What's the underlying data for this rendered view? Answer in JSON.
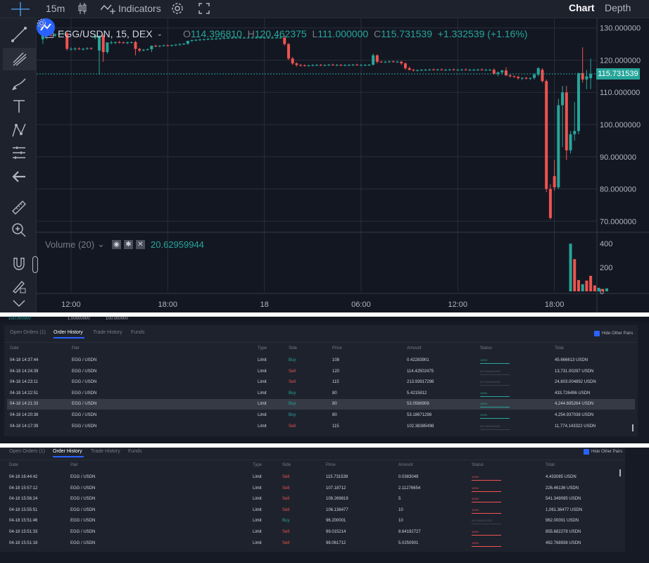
{
  "toolbar": {
    "interval": "15m",
    "indicators_label": "Indicators",
    "chart_tab": "Chart",
    "depth_tab": "Depth"
  },
  "legend": {
    "symbol": "EGG/USDN, 15, DEX",
    "ohlc": {
      "o_key": "O",
      "o_val": "114.396810",
      "h_key": "H",
      "h_val": "120.462375",
      "l_key": "L",
      "l_val": "111.000000",
      "c_key": "C",
      "c_val": "115.731539",
      "change": "+1.332539 (+1.16%)"
    },
    "volume_label": "Volume (20)",
    "volume_value": "20.62959944"
  },
  "price_badge": "115.731539",
  "colors": {
    "up": "#26a69a",
    "down": "#ef5350",
    "accent": "#2962ff",
    "bg": "#131722"
  },
  "chart_data": {
    "type": "candlestick",
    "price_axis_ticks": [
      "130.000000",
      "120.000000",
      "110.000000",
      "100.000000",
      "90.000000",
      "80.000000",
      "70.000000"
    ],
    "price_axis_values": [
      130,
      120,
      110,
      100,
      90,
      80,
      70
    ],
    "volume_axis_ticks": [
      "400",
      "200",
      "0"
    ],
    "volume_axis_values": [
      400,
      200,
      0
    ],
    "time_ticks": [
      "12:00",
      "18:00",
      "18",
      "06:00",
      "12:00",
      "18:00"
    ],
    "time_tick_index": [
      7,
      31,
      55,
      79,
      103,
      127
    ],
    "ylim": [
      67,
      133
    ],
    "volume_ylim": [
      0,
      460
    ],
    "last_price": 115.731539,
    "candles": [
      {
        "o": 126.5,
        "h": 127.8,
        "l": 125.0,
        "c": 128.0
      },
      {
        "o": 127.5,
        "h": 128.5,
        "l": 126.5,
        "c": 127.8
      },
      {
        "o": 127.8,
        "h": 128.2,
        "l": 127.2,
        "c": 127.6
      },
      {
        "o": 127.6,
        "h": 128.4,
        "l": 127.2,
        "c": 128.0
      },
      {
        "o": 128.0,
        "h": 128.5,
        "l": 127.6,
        "c": 128.2
      },
      {
        "o": 128.2,
        "h": 128.5,
        "l": 127.8,
        "c": 128.3
      },
      {
        "o": 128.3,
        "h": 128.6,
        "l": 123.0,
        "c": 123.5
      },
      {
        "o": 123.5,
        "h": 124.0,
        "l": 123.0,
        "c": 123.5
      },
      {
        "o": 123.5,
        "h": 124.0,
        "l": 123.0,
        "c": 123.6
      },
      {
        "o": 123.6,
        "h": 124.0,
        "l": 123.2,
        "c": 123.4
      },
      {
        "o": 123.4,
        "h": 123.8,
        "l": 123.0,
        "c": 123.5
      },
      {
        "o": 123.5,
        "h": 124.0,
        "l": 123.2,
        "c": 123.7
      },
      {
        "o": 123.7,
        "h": 124.0,
        "l": 123.3,
        "c": 123.6
      },
      {
        "o": 127.0,
        "h": 128.0,
        "l": 126.5,
        "c": 127.6
      },
      {
        "o": 123.0,
        "h": 127.6,
        "l": 115.5,
        "c": 127.6
      },
      {
        "o": 127.6,
        "h": 128.0,
        "l": 119.5,
        "c": 122.5
      },
      {
        "o": 122.5,
        "h": 125.5,
        "l": 122.0,
        "c": 125.5
      },
      {
        "o": 125.5,
        "h": 126.0,
        "l": 125.0,
        "c": 125.5
      },
      {
        "o": 125.5,
        "h": 125.8,
        "l": 125.0,
        "c": 125.6
      },
      {
        "o": 125.6,
        "h": 126.0,
        "l": 125.2,
        "c": 125.5
      },
      {
        "o": 125.5,
        "h": 125.8,
        "l": 125.2,
        "c": 125.4
      },
      {
        "o": 125.4,
        "h": 125.8,
        "l": 125.0,
        "c": 125.5
      },
      {
        "o": 125.5,
        "h": 125.8,
        "l": 125.2,
        "c": 125.6
      },
      {
        "o": 125.6,
        "h": 126.0,
        "l": 121.5,
        "c": 123.5
      },
      {
        "o": 123.5,
        "h": 123.8,
        "l": 122.5,
        "c": 123.0
      },
      {
        "o": 123.0,
        "h": 123.5,
        "l": 122.8,
        "c": 123.2
      },
      {
        "o": 123.2,
        "h": 123.6,
        "l": 123.0,
        "c": 123.4
      },
      {
        "o": 123.4,
        "h": 123.8,
        "l": 122.5,
        "c": 124.5
      },
      {
        "o": 124.5,
        "h": 124.8,
        "l": 124.0,
        "c": 124.3
      },
      {
        "o": 124.3,
        "h": 124.6,
        "l": 124.0,
        "c": 124.5
      },
      {
        "o": 124.5,
        "h": 124.8,
        "l": 124.2,
        "c": 124.6
      },
      {
        "o": 124.6,
        "h": 124.9,
        "l": 124.3,
        "c": 124.5
      },
      {
        "o": 124.5,
        "h": 124.8,
        "l": 124.2,
        "c": 124.7
      },
      {
        "o": 124.7,
        "h": 125.0,
        "l": 124.4,
        "c": 124.8
      },
      {
        "o": 124.8,
        "h": 125.2,
        "l": 124.5,
        "c": 125.0
      },
      {
        "o": 125.0,
        "h": 125.3,
        "l": 124.7,
        "c": 125.1
      },
      {
        "o": 125.1,
        "h": 126.0,
        "l": 124.8,
        "c": 126.0
      },
      {
        "o": 126.0,
        "h": 126.4,
        "l": 125.7,
        "c": 126.2
      },
      {
        "o": 126.2,
        "h": 126.5,
        "l": 125.9,
        "c": 126.3
      },
      {
        "o": 126.3,
        "h": 126.6,
        "l": 126.0,
        "c": 126.4
      },
      {
        "o": 126.4,
        "h": 126.7,
        "l": 126.1,
        "c": 126.5
      },
      {
        "o": 126.5,
        "h": 126.8,
        "l": 126.2,
        "c": 126.6
      },
      {
        "o": 126.6,
        "h": 126.9,
        "l": 126.3,
        "c": 126.6
      },
      {
        "o": 126.6,
        "h": 126.9,
        "l": 126.3,
        "c": 126.7
      },
      {
        "o": 126.7,
        "h": 127.0,
        "l": 126.4,
        "c": 126.8
      },
      {
        "o": 126.8,
        "h": 127.1,
        "l": 126.5,
        "c": 126.9
      },
      {
        "o": 126.9,
        "h": 127.2,
        "l": 126.6,
        "c": 126.9
      },
      {
        "o": 126.9,
        "h": 127.2,
        "l": 126.6,
        "c": 127.0
      },
      {
        "o": 127.0,
        "h": 127.3,
        "l": 126.7,
        "c": 127.0
      },
      {
        "o": 127.0,
        "h": 127.3,
        "l": 126.7,
        "c": 127.0
      },
      {
        "o": 127.0,
        "h": 127.3,
        "l": 126.7,
        "c": 127.0
      },
      {
        "o": 127.0,
        "h": 127.3,
        "l": 126.7,
        "c": 127.0
      },
      {
        "o": 127.0,
        "h": 127.3,
        "l": 126.7,
        "c": 127.0
      },
      {
        "o": 127.0,
        "h": 127.3,
        "l": 126.7,
        "c": 127.0
      },
      {
        "o": 127.0,
        "h": 127.3,
        "l": 126.7,
        "c": 127.0
      },
      {
        "o": 127.0,
        "h": 127.3,
        "l": 126.7,
        "c": 127.0
      },
      {
        "o": 127.0,
        "h": 127.3,
        "l": 126.7,
        "c": 127.0
      },
      {
        "o": 127.0,
        "h": 127.3,
        "l": 126.7,
        "c": 127.0
      },
      {
        "o": 127.0,
        "h": 127.3,
        "l": 126.7,
        "c": 127.0
      },
      {
        "o": 127.0,
        "h": 127.3,
        "l": 126.7,
        "c": 127.0
      },
      {
        "o": 127.0,
        "h": 127.5,
        "l": 124.5,
        "c": 125.0
      },
      {
        "o": 125.0,
        "h": 125.3,
        "l": 120.0,
        "c": 120.5
      },
      {
        "o": 120.5,
        "h": 121.0,
        "l": 118.5,
        "c": 119.0
      },
      {
        "o": 119.0,
        "h": 119.3,
        "l": 118.0,
        "c": 118.5
      },
      {
        "o": 118.5,
        "h": 118.8,
        "l": 118.0,
        "c": 118.4
      },
      {
        "o": 118.4,
        "h": 118.7,
        "l": 118.0,
        "c": 118.3
      },
      {
        "o": 118.3,
        "h": 118.6,
        "l": 118.0,
        "c": 118.4
      },
      {
        "o": 118.4,
        "h": 118.7,
        "l": 118.1,
        "c": 118.5
      },
      {
        "o": 118.5,
        "h": 118.8,
        "l": 118.2,
        "c": 118.5
      },
      {
        "o": 118.5,
        "h": 118.8,
        "l": 118.2,
        "c": 118.4
      },
      {
        "o": 118.4,
        "h": 118.7,
        "l": 118.1,
        "c": 118.5
      },
      {
        "o": 118.5,
        "h": 118.8,
        "l": 118.2,
        "c": 118.6
      },
      {
        "o": 118.6,
        "h": 118.9,
        "l": 118.3,
        "c": 118.5
      },
      {
        "o": 118.5,
        "h": 118.8,
        "l": 118.2,
        "c": 118.5
      },
      {
        "o": 118.5,
        "h": 118.8,
        "l": 118.2,
        "c": 118.4
      },
      {
        "o": 118.4,
        "h": 118.7,
        "l": 118.1,
        "c": 118.5
      },
      {
        "o": 118.5,
        "h": 118.8,
        "l": 118.2,
        "c": 118.5
      },
      {
        "o": 118.5,
        "h": 118.8,
        "l": 118.2,
        "c": 118.6
      },
      {
        "o": 118.6,
        "h": 118.9,
        "l": 118.3,
        "c": 118.5
      },
      {
        "o": 118.5,
        "h": 118.8,
        "l": 118.2,
        "c": 118.5
      },
      {
        "o": 118.5,
        "h": 118.8,
        "l": 118.2,
        "c": 118.5
      },
      {
        "o": 118.5,
        "h": 118.8,
        "l": 118.2,
        "c": 118.6
      },
      {
        "o": 118.6,
        "h": 122.0,
        "l": 118.3,
        "c": 121.5
      },
      {
        "o": 121.5,
        "h": 121.8,
        "l": 119.0,
        "c": 119.5
      },
      {
        "o": 119.5,
        "h": 119.8,
        "l": 119.2,
        "c": 119.4
      },
      {
        "o": 119.4,
        "h": 119.7,
        "l": 119.1,
        "c": 119.5
      },
      {
        "o": 119.5,
        "h": 119.8,
        "l": 119.2,
        "c": 119.6
      },
      {
        "o": 119.6,
        "h": 119.9,
        "l": 119.3,
        "c": 119.5
      },
      {
        "o": 119.5,
        "h": 119.8,
        "l": 119.2,
        "c": 119.5
      },
      {
        "o": 119.5,
        "h": 119.8,
        "l": 118.5,
        "c": 119.0
      },
      {
        "o": 119.0,
        "h": 119.3,
        "l": 117.0,
        "c": 117.5
      },
      {
        "o": 117.5,
        "h": 118.0,
        "l": 116.8,
        "c": 117.0
      },
      {
        "o": 117.0,
        "h": 117.3,
        "l": 116.5,
        "c": 116.8
      },
      {
        "o": 116.8,
        "h": 117.1,
        "l": 116.5,
        "c": 116.9
      },
      {
        "o": 116.9,
        "h": 117.2,
        "l": 116.6,
        "c": 117.0
      },
      {
        "o": 117.0,
        "h": 117.3,
        "l": 116.7,
        "c": 117.0
      },
      {
        "o": 117.0,
        "h": 117.3,
        "l": 116.7,
        "c": 117.1
      },
      {
        "o": 117.1,
        "h": 117.4,
        "l": 116.8,
        "c": 117.0
      },
      {
        "o": 117.0,
        "h": 117.3,
        "l": 116.7,
        "c": 117.1
      },
      {
        "o": 117.1,
        "h": 117.4,
        "l": 116.8,
        "c": 117.0
      },
      {
        "o": 117.0,
        "h": 117.3,
        "l": 116.7,
        "c": 117.0
      },
      {
        "o": 117.0,
        "h": 117.3,
        "l": 116.7,
        "c": 117.1
      },
      {
        "o": 117.1,
        "h": 117.4,
        "l": 116.8,
        "c": 117.0
      },
      {
        "o": 117.0,
        "h": 117.3,
        "l": 116.7,
        "c": 117.0
      },
      {
        "o": 117.0,
        "h": 117.3,
        "l": 116.7,
        "c": 117.1
      },
      {
        "o": 117.1,
        "h": 117.4,
        "l": 116.8,
        "c": 117.0
      },
      {
        "o": 117.0,
        "h": 117.3,
        "l": 116.7,
        "c": 117.0
      },
      {
        "o": 117.0,
        "h": 117.3,
        "l": 116.7,
        "c": 117.0
      },
      {
        "o": 117.0,
        "h": 117.3,
        "l": 116.7,
        "c": 117.1
      },
      {
        "o": 117.1,
        "h": 117.4,
        "l": 116.8,
        "c": 117.0
      },
      {
        "o": 117.0,
        "h": 117.3,
        "l": 116.7,
        "c": 117.0
      },
      {
        "o": 117.0,
        "h": 117.3,
        "l": 116.7,
        "c": 117.0
      },
      {
        "o": 117.0,
        "h": 117.5,
        "l": 115.5,
        "c": 115.8
      },
      {
        "o": 115.8,
        "h": 116.5,
        "l": 115.0,
        "c": 116.2
      },
      {
        "o": 116.2,
        "h": 117.0,
        "l": 115.5,
        "c": 116.8
      },
      {
        "o": 116.8,
        "h": 117.8,
        "l": 115.0,
        "c": 115.3
      },
      {
        "o": 115.3,
        "h": 115.8,
        "l": 114.6,
        "c": 115.0
      },
      {
        "o": 115.0,
        "h": 115.3,
        "l": 114.5,
        "c": 114.8
      },
      {
        "o": 114.8,
        "h": 115.2,
        "l": 114.0,
        "c": 114.4
      },
      {
        "o": 114.4,
        "h": 114.7,
        "l": 113.8,
        "c": 114.5
      },
      {
        "o": 114.5,
        "h": 114.8,
        "l": 114.0,
        "c": 114.3
      },
      {
        "o": 114.3,
        "h": 114.6,
        "l": 113.8,
        "c": 114.5
      },
      {
        "o": 114.5,
        "h": 116.0,
        "l": 114.0,
        "c": 115.5
      },
      {
        "o": 115.5,
        "h": 117.8,
        "l": 115.0,
        "c": 117.5
      },
      {
        "o": 117.0,
        "h": 117.5,
        "l": 113.0,
        "c": 113.5
      },
      {
        "o": 113.5,
        "h": 114.0,
        "l": 79.0,
        "c": 80.0
      },
      {
        "o": 80.0,
        "h": 81.5,
        "l": 70.5,
        "c": 71.0
      },
      {
        "o": 84.0,
        "h": 89.0,
        "l": 79.5,
        "c": 80.5
      },
      {
        "o": 80.5,
        "h": 108.0,
        "l": 80.0,
        "c": 106.0
      },
      {
        "o": 106.0,
        "h": 112.0,
        "l": 93.0,
        "c": 110.0
      },
      {
        "o": 110.0,
        "h": 112.0,
        "l": 89.0,
        "c": 92.0
      },
      {
        "o": 92.0,
        "h": 98.0,
        "l": 91.0,
        "c": 97.0
      },
      {
        "o": 97.0,
        "h": 107.0,
        "l": 95.0,
        "c": 98.0
      },
      {
        "o": 98.0,
        "h": 116.0,
        "l": 97.0,
        "c": 116.0
      },
      {
        "o": 116.0,
        "h": 124.0,
        "l": 113.0,
        "c": 114.0
      },
      {
        "o": 114.0,
        "h": 117.0,
        "l": 111.0,
        "c": 115.0
      },
      {
        "o": 114.4,
        "h": 120.5,
        "l": 111.0,
        "c": 115.7
      }
    ],
    "volumes": [
      {
        "i": 131,
        "v": 400,
        "up": true
      },
      {
        "i": 132,
        "v": 270,
        "up": false
      },
      {
        "i": 133,
        "v": 95,
        "up": false
      },
      {
        "i": 134,
        "v": 60,
        "up": true
      },
      {
        "i": 135,
        "v": 90,
        "up": false
      },
      {
        "i": 136,
        "v": 130,
        "up": false
      },
      {
        "i": 137,
        "v": 50,
        "up": false
      },
      {
        "i": 138,
        "v": 30,
        "up": true
      },
      {
        "i": 139,
        "v": 20,
        "up": false
      },
      {
        "i": 140,
        "v": 25,
        "up": true
      }
    ]
  },
  "panel_top": {
    "strip_left_a": "100.000000",
    "strip_left_b": "1.00000000",
    "strip_left_c": "100.000000",
    "tabs": [
      "Open Orders (1)",
      "Order History",
      "Trade History",
      "Funds"
    ],
    "hide_label": "Hide Other Pairs",
    "headers": [
      "Date",
      "Pair",
      "Type",
      "Side",
      "Price",
      "Amount",
      "Status",
      "Total"
    ],
    "rows": [
      {
        "date": "04-18 14:37:44",
        "pair": "EGG / USDN",
        "type": "Limit",
        "side": "Buy",
        "price": "108",
        "amount": "0.42283901",
        "status": "100%",
        "total": "45.666613 USDN"
      },
      {
        "date": "04-18 14:24:39",
        "pair": "EGG / USDN",
        "type": "Limit",
        "side": "Sell",
        "price": "120",
        "amount": "114.42502475",
        "status": "0% CANCELED",
        "total": "13,731.00297 USDN"
      },
      {
        "date": "04-18 14:23:11",
        "pair": "EGG / USDN",
        "type": "Limit",
        "side": "Sell",
        "price": "115",
        "amount": "213.93917298",
        "status": "0% CANCELED",
        "total": "24,603.004892 USDN"
      },
      {
        "date": "04-18 14:22:51",
        "pair": "EGG / USDN",
        "type": "Limit",
        "side": "Buy",
        "price": "80",
        "amount": "5.4215812",
        "status": "100%",
        "total": "433.726496 USDN"
      },
      {
        "date": "04-18 14:21:33",
        "pair": "EGG / USDN",
        "type": "Limit",
        "side": "Buy",
        "price": "80",
        "amount": "53.0586908",
        "status": "100%",
        "total": "4,244.695264 USDN"
      },
      {
        "date": "04-18 14:20:38",
        "pair": "EGG / USDN",
        "type": "Limit",
        "side": "Buy",
        "price": "80",
        "amount": "53.18671298",
        "status": "100%",
        "total": "4,254.937038 USDN"
      },
      {
        "date": "04-18 14:17:39",
        "pair": "EGG / USDN",
        "type": "Limit",
        "side": "Sell",
        "price": "115",
        "amount": "102.38385498",
        "status": "0% CANCELED",
        "total": "11,774.143322 USDN"
      }
    ]
  },
  "panel_bottom": {
    "tabs": [
      "Open Orders (1)",
      "Order History",
      "Trade History",
      "Funds"
    ],
    "hide_label": "Hide Other Pairs",
    "headers": [
      "Date",
      "Pair",
      "Type",
      "Side",
      "Price",
      "Amount",
      "Status",
      "Total"
    ],
    "rows": [
      {
        "date": "04-18 16:44:42",
        "pair": "EGG / USDN",
        "type": "Limit",
        "side": "Sell",
        "price": "115.731539",
        "amount": "0.0383049",
        "status": "100%",
        "total": "4.433085 USDN"
      },
      {
        "date": "04-18 15:57:12",
        "pair": "EGG / USDN",
        "type": "Limit",
        "side": "Sell",
        "price": "107.18712",
        "amount": "2.11276654",
        "status": "100%",
        "total": "226.46136 USDN"
      },
      {
        "date": "04-18 15:56:24",
        "pair": "EGG / USDN",
        "type": "Limit",
        "side": "Sell",
        "price": "108.269819",
        "amount": "5",
        "status": "100%",
        "total": "541.349095 USDN"
      },
      {
        "date": "04-18 15:55:51",
        "pair": "EGG / USDN",
        "type": "Limit",
        "side": "Sell",
        "price": "106.136477",
        "amount": "10",
        "status": "100%",
        "total": "1,061.36477 USDN"
      },
      {
        "date": "04-18 15:51:46",
        "pair": "EGG / USDN",
        "type": "Limit",
        "side": "Buy",
        "price": "96.200001",
        "amount": "10",
        "status": "0% CANCELED",
        "total": "962.00001 USDN"
      },
      {
        "date": "04-18 15:51:33",
        "pair": "EGG / USDN",
        "type": "Limit",
        "side": "Sell",
        "price": "99.015214",
        "amount": "8.64192727",
        "status": "100%",
        "total": "855.682278 USDN"
      },
      {
        "date": "04-18 15:51:18",
        "pair": "EGG / USDN",
        "type": "Limit",
        "side": "Sell",
        "price": "98.061712",
        "amount": "5.0250901",
        "status": "100%",
        "total": "492.768938 USDN"
      }
    ]
  }
}
